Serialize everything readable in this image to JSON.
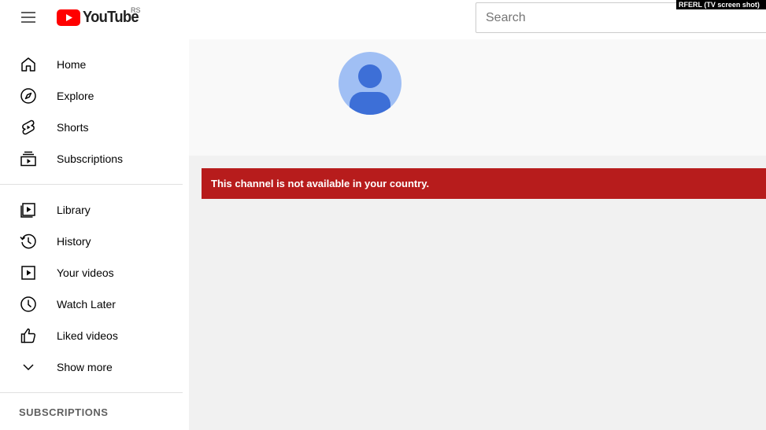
{
  "header": {
    "logo_text": "YouTube",
    "country_code": "RS",
    "search_placeholder": "Search",
    "watermark": "RFERL (TV screen shot)"
  },
  "sidebar": {
    "primary": [
      {
        "label": "Home",
        "icon": "home-icon"
      },
      {
        "label": "Explore",
        "icon": "explore-compass-icon"
      },
      {
        "label": "Shorts",
        "icon": "shorts-icon"
      },
      {
        "label": "Subscriptions",
        "icon": "subscriptions-icon"
      }
    ],
    "secondary": [
      {
        "label": "Library",
        "icon": "library-icon"
      },
      {
        "label": "History",
        "icon": "history-icon"
      },
      {
        "label": "Your videos",
        "icon": "your-videos-icon"
      },
      {
        "label": "Watch Later",
        "icon": "watch-later-icon"
      },
      {
        "label": "Liked videos",
        "icon": "liked-videos-icon"
      },
      {
        "label": "Show more",
        "icon": "chevron-down-icon"
      }
    ],
    "subscriptions_title": "SUBSCRIPTIONS"
  },
  "channel": {
    "alert_text": "This channel is not available in your country."
  },
  "colors": {
    "brand_red": "#ff0000",
    "alert_red": "#b71c1c",
    "avatar_bg": "#a0bff4",
    "avatar_fg": "#3d6fd7"
  }
}
